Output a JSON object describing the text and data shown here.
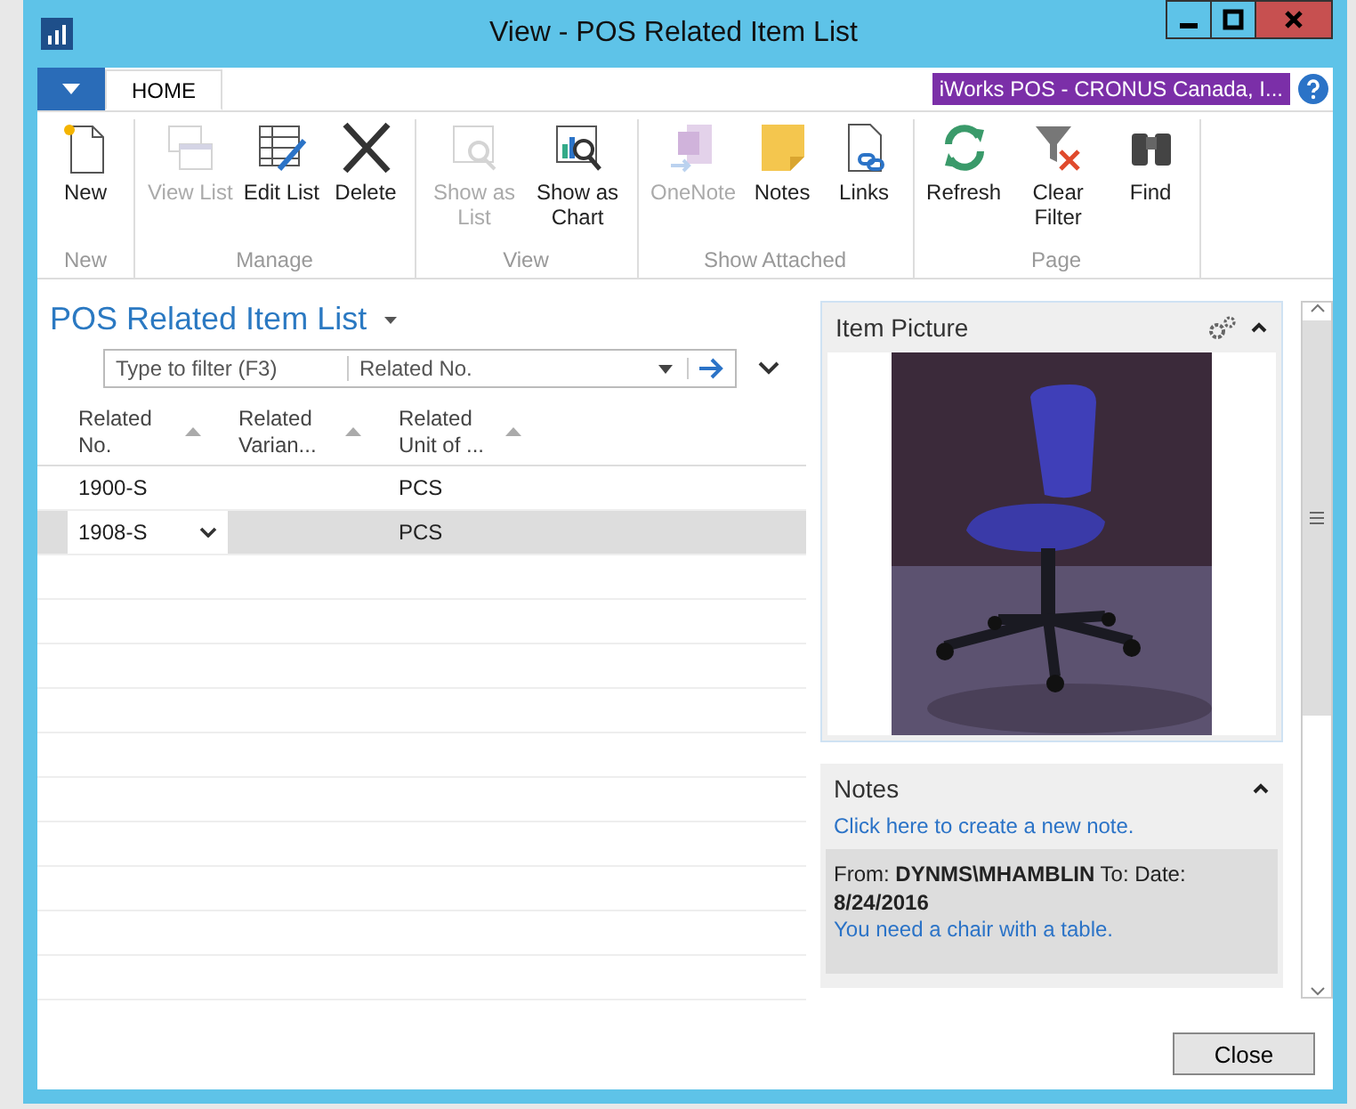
{
  "window": {
    "title": "View - POS Related Item List"
  },
  "ribbon": {
    "tabs": [
      {
        "label": "HOME",
        "selected": true
      }
    ],
    "company": "iWorks POS - CRONUS Canada, I...",
    "groups": [
      {
        "label": "New",
        "buttons": [
          {
            "label": "New",
            "disabled": false
          }
        ]
      },
      {
        "label": "Manage",
        "buttons": [
          {
            "label": "View List",
            "disabled": true
          },
          {
            "label": "Edit List",
            "disabled": false
          },
          {
            "label": "Delete",
            "disabled": false
          }
        ]
      },
      {
        "label": "View",
        "buttons": [
          {
            "label": "Show as List",
            "disabled": true
          },
          {
            "label": "Show as Chart",
            "disabled": false
          }
        ]
      },
      {
        "label": "Show Attached",
        "buttons": [
          {
            "label": "OneNote",
            "disabled": true
          },
          {
            "label": "Notes",
            "disabled": false
          },
          {
            "label": "Links",
            "disabled": false
          }
        ]
      },
      {
        "label": "Page",
        "buttons": [
          {
            "label": "Refresh",
            "disabled": false
          },
          {
            "label": "Clear Filter",
            "disabled": false
          },
          {
            "label": "Find",
            "disabled": false
          }
        ]
      }
    ]
  },
  "list": {
    "title": "POS Related Item List",
    "filter": {
      "placeholder": "Type to filter (F3)",
      "field": "Related No."
    },
    "columns": [
      "Related No.",
      "Related Varian...",
      "Related Unit of ..."
    ],
    "rows": [
      {
        "cells": [
          "1900-S",
          "",
          "PCS"
        ],
        "selected": false
      },
      {
        "cells": [
          "1908-S",
          "",
          "PCS"
        ],
        "selected": true
      }
    ]
  },
  "item_picture": {
    "title": "Item Picture",
    "kind": "picture"
  },
  "notes": {
    "title": "Notes",
    "create_link": "Click here to create a new note.",
    "note": {
      "header": "From: **DYNMS\\MHAMBLIN** To:  Date: **8/24/2016**",
      "text": "You need a chair with a table."
    }
  },
  "buttons": [
    "Close"
  ]
}
